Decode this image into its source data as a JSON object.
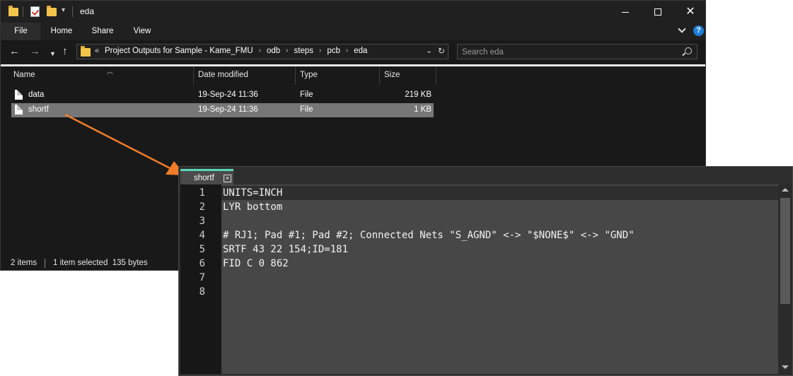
{
  "explorer": {
    "title": "eda",
    "window_buttons": {
      "minimize": "",
      "maximize": "",
      "close": "✕"
    },
    "ribbon": {
      "tabs": [
        "File",
        "Home",
        "Share",
        "View"
      ],
      "help": "?"
    },
    "nav": {
      "back": "←",
      "forward": "→",
      "recent": "⌄",
      "up": "↑",
      "overflow": "«",
      "breadcrumbs": [
        "Project Outputs for Sample - Kame_FMU",
        "odb",
        "steps",
        "pcb",
        "eda"
      ],
      "crumb_sep": "›",
      "address_dropdown": "⌄",
      "refresh": "↻"
    },
    "search": {
      "placeholder": "Search eda"
    },
    "columns": [
      "Name",
      "Date modified",
      "Type",
      "Size"
    ],
    "files": [
      {
        "name": "data",
        "date": "19-Sep-24 11:36",
        "type": "File",
        "size": "219 KB",
        "selected": false
      },
      {
        "name": "shortf",
        "date": "19-Sep-24 11:36",
        "type": "File",
        "size": "1 KB",
        "selected": true
      }
    ],
    "status": {
      "items": "2 items",
      "selection": "1 item selected  135 bytes"
    }
  },
  "editor": {
    "tab_label": "shortf",
    "tab_close": "×",
    "accent_color": "#5ad6b8",
    "line_numbers": [
      "1",
      "2",
      "3",
      "4",
      "5",
      "6",
      "7",
      "8"
    ],
    "lines": [
      "UNITS=INCH",
      "LYR bottom",
      "",
      "# RJ1; Pad #1; Pad #2; Connected Nets \"S_AGND\" <-> \"$NONE$\" <-> \"GND\"",
      "SRTF 43 22 154;ID=181",
      "FID C 0 862",
      "",
      ""
    ]
  },
  "arrow_color": "#f07c2a"
}
